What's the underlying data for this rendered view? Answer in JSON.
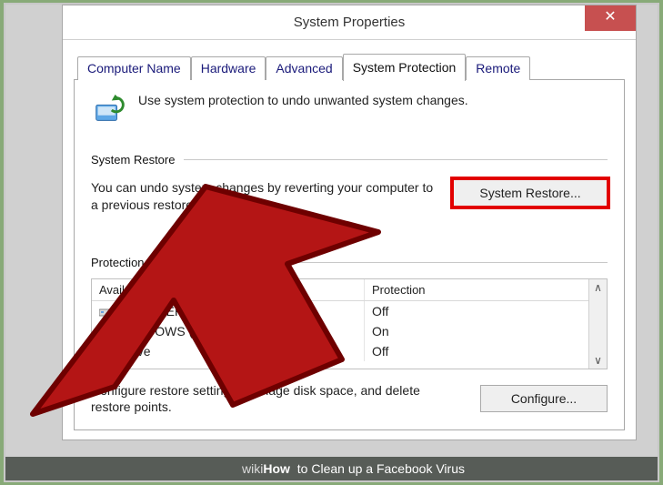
{
  "window": {
    "title": "System Properties",
    "close_glyph": "✕"
  },
  "tabs": {
    "computer_name": "Computer Name",
    "hardware": "Hardware",
    "advanced": "Advanced",
    "system_protection": "System Protection",
    "remote": "Remote"
  },
  "intro": "Use system protection to undo unwanted system changes.",
  "sections": {
    "restore": {
      "heading": "System Restore",
      "description": "You can undo system changes by reverting your computer to a previous restore point.",
      "button": "System Restore..."
    },
    "protection": {
      "heading": "Protection Settings",
      "col_drive": "Available Drives",
      "col_protection": "Protection",
      "rows": [
        {
          "label": "RECOVERY",
          "protection": "Off"
        },
        {
          "label": "WINDOWS (C:) (System)",
          "protection": "On"
        },
        {
          "label": "Drive",
          "protection": "Off"
        }
      ],
      "configure_text": "Configure restore settings, manage disk space, and delete restore points.",
      "configure_button": "Configure..."
    }
  },
  "caption": {
    "brand": "wiki",
    "bold": "How",
    "rest": " to Clean up a Facebook Virus"
  }
}
